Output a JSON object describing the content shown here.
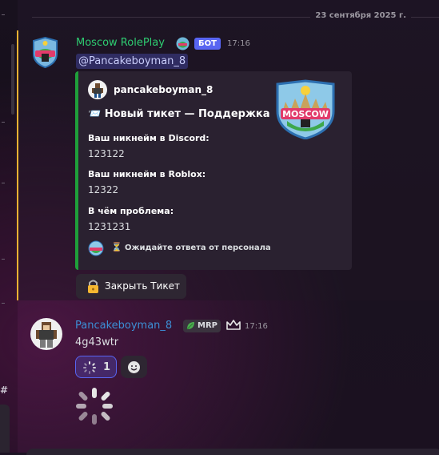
{
  "date_divider": "23 сентября 2025 г.",
  "message1": {
    "username": "Moscow RolePlay",
    "bot_tag": "БОТ",
    "time": "17:16",
    "mention": "@Pancakeboyman_8",
    "embed": {
      "author": "pancakeboyman_8",
      "title": "📨 Новый тикет — Поддержка",
      "fields": [
        {
          "name": "Ваш никнейм в Discord:",
          "value": "123122"
        },
        {
          "name": "Ваш никнейм в Roblox:",
          "value": "12322"
        },
        {
          "name": "В чём проблема:",
          "value": "1231231"
        }
      ],
      "footer_hourglass": "⏳",
      "footer": "Ожидайте ответа от персонала",
      "accent_color": "#1f9f3a",
      "thumbnail_text": "MOSCOW"
    },
    "button_label": "Закрыть Тикет"
  },
  "message2": {
    "username": "Pancakeboyman_8",
    "tag": "MRP",
    "time": "17:16",
    "text": "4g43wtr",
    "reaction_count": "1"
  },
  "colors": {
    "bot_name": "#2ecc71",
    "user_name": "#3c8fd6",
    "bot_tag": "#5865f2",
    "mention_bar": "#f0b232"
  },
  "icons": [
    "robot-icon",
    "lock-icon",
    "hourglass-icon",
    "leaf-icon",
    "crown-icon",
    "smile-icon",
    "loading-spinner-icon"
  ]
}
